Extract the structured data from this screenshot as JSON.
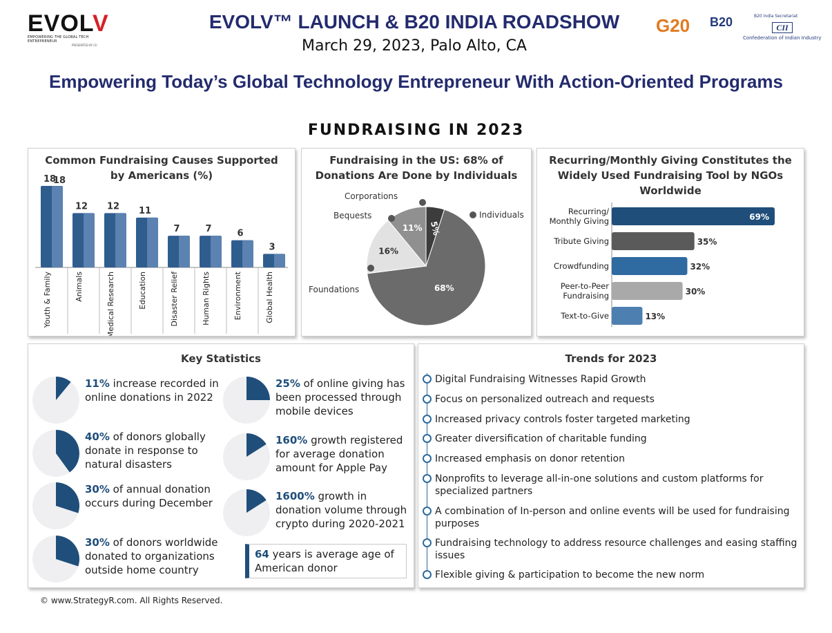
{
  "header": {
    "logo_word_main": "EVOL",
    "logo_word_accent": "V",
    "logo_tagline": "EMPOWERING THE GLOBAL TECH ENTREPRENEUR",
    "logo_presented": "PRESENTED BY CII",
    "title": "EVOLV™ LAUNCH & B20 INDIA ROADSHOW",
    "date_line": "March 29, 2023, Palo Alto, CA",
    "partner_g20": "G20",
    "partner_b20": "B20",
    "partner_cii_top": "B20 India Secretariat",
    "partner_cii_box": "CII",
    "partner_cii_name": "Confederation of Indian Industry"
  },
  "subtitle": "Empowering Today’s Global Technology Entrepreneur With Action-Oriented Programs",
  "section_title": "FUNDRAISING IN 2023",
  "chart_data": [
    {
      "type": "bar",
      "title": "Common Fundraising Causes Supported by Americans (%)",
      "categories": [
        "Youth & Family",
        "Animals",
        "Medical Research",
        "Education",
        "Disaster Relief",
        "Human Rights",
        "Environment",
        "Global Health"
      ],
      "values": [
        18,
        12,
        12,
        11,
        7,
        7,
        6,
        3
      ],
      "extra_labels": [
        "18",
        "",
        "",
        "",
        "",
        "",
        "",
        ""
      ],
      "color": "#2f5d8e",
      "color_light": "#5b82b0",
      "ylim": [
        0,
        20
      ]
    },
    {
      "type": "pie",
      "title": "Fundraising in the US: 68% of Donations Are Done by Individuals",
      "slices": [
        {
          "label": "Individuals",
          "value": 68,
          "display": "68%",
          "color": "#6b6b6b"
        },
        {
          "label": "Foundations",
          "value": 16,
          "display": "16%",
          "color": "#e2e2e2"
        },
        {
          "label": "Bequests",
          "value": 11,
          "display": "11%",
          "color": "#909090"
        },
        {
          "label": "Corporations",
          "value": 5,
          "display": "5%",
          "color": "#3c3c3c"
        }
      ]
    },
    {
      "type": "bar",
      "orientation": "horizontal",
      "title": "Recurring/Monthly Giving Constitutes the Widely Used Fundraising Tool by NGOs Worldwide",
      "categories": [
        "Recurring/ Monthly Giving",
        "Tribute Giving",
        "Crowdfunding",
        "Peer-to-Peer Fundraising",
        "Text-to-Give"
      ],
      "values": [
        69,
        35,
        32,
        30,
        13
      ],
      "display": [
        "69%",
        "35%",
        "32%",
        "30%",
        "13%"
      ],
      "colors": [
        "#1f4e7a",
        "#5a5a5a",
        "#2f6aa0",
        "#a9a9a9",
        "#4d7fb0"
      ],
      "xlim": [
        0,
        69
      ]
    }
  ],
  "key_stats": {
    "title": "Key Statistics",
    "items": [
      {
        "value": "11%",
        "text": " increase recorded in online donations in 2022",
        "fraction": 0.11
      },
      {
        "value": "40%",
        "text": " of donors globally donate in response to natural disasters",
        "fraction": 0.4
      },
      {
        "value": "30%",
        "text": " of annual donation occurs during December",
        "fraction": 0.3
      },
      {
        "value": "30%",
        "text": " of donors worldwide donated to organizations outside home country",
        "fraction": 0.3
      },
      {
        "value": "25%",
        "text": " of online giving has been processed through mobile devices",
        "fraction": 0.25
      },
      {
        "value": "160%",
        "text": " growth registered for average donation amount for Apple Pay",
        "fraction": 0.16
      },
      {
        "value": "1600%",
        "text": " growth in donation volume through crypto during 2020-2021",
        "fraction": 0.16
      }
    ],
    "avg_value": "64",
    "avg_text": " years is average age of American donor",
    "pie_color": "#1f4e7a",
    "pie_bg": "#efeff1"
  },
  "trends": {
    "title": "Trends for 2023",
    "items": [
      "Digital Fundraising Witnesses Rapid Growth",
      "Focus on personalized outreach and requests",
      "Increased privacy controls foster targeted marketing",
      "Greater diversification of charitable funding",
      "Increased emphasis on donor retention",
      "Nonprofits to leverage all-in-one solutions and custom platforms for specialized partners",
      "A combination of In-person and online events will be used for fundraising purposes",
      "Fundraising technology to address resource challenges and easing staffing issues",
      "Flexible giving & participation to become the new norm"
    ]
  },
  "footer": {
    "copyright": "© www.StrategyR.com. All Rights Reserved."
  }
}
